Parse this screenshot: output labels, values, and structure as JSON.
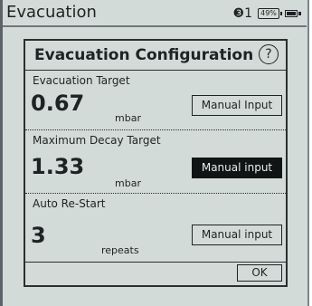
{
  "header": {
    "title": "Evacuation",
    "bluetooth_label": "❸1",
    "battery_label": "49%"
  },
  "dialog": {
    "title": "Evacuation Configuration",
    "help_label": "?",
    "sections": [
      {
        "label": "Evacuation Target",
        "value": "0.67",
        "unit": "mbar",
        "button": "Manual Input"
      },
      {
        "label": "Maximum Decay Target",
        "value": "1.33",
        "unit": "mbar",
        "button": "Manual input"
      },
      {
        "label": "Auto Re-Start",
        "value": "3",
        "unit": "repeats",
        "button": "Manual input"
      }
    ],
    "ok_label": "OK"
  },
  "colors": {
    "background": "#d3dbd8",
    "text": "#1e2224",
    "selected_button": "#111415"
  },
  "icons": [
    "bluetooth-icon",
    "battery-icon",
    "power-plug-icon",
    "help-icon"
  ]
}
